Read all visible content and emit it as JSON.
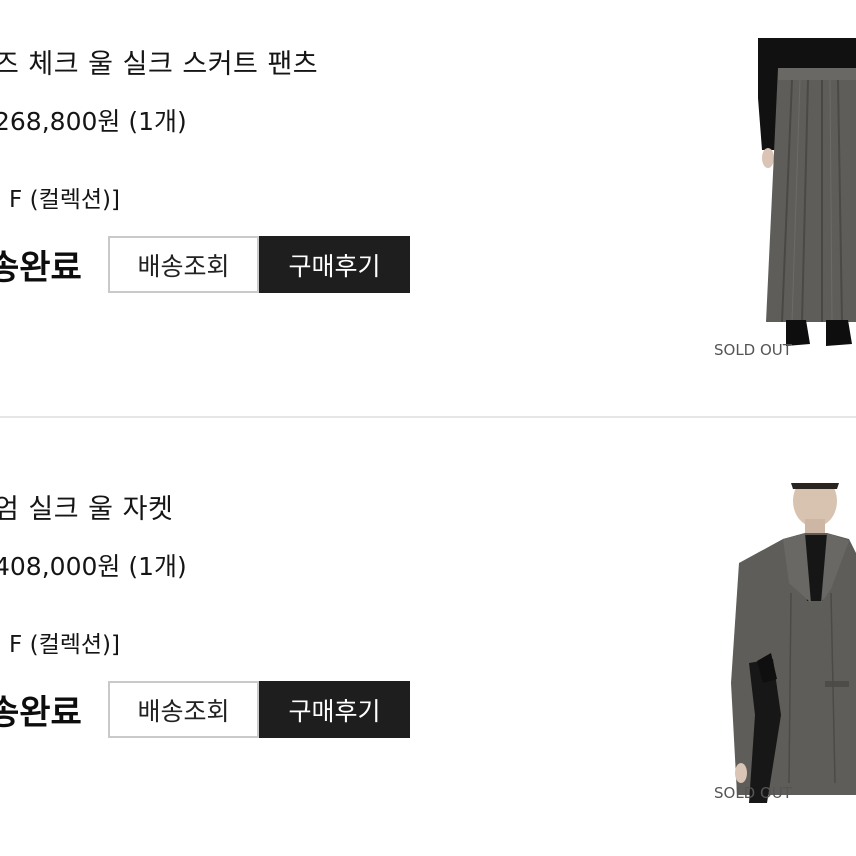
{
  "orders": [
    {
      "name": "즈 체크 울 실크 스커트 팬츠",
      "price": "268,800원 (1개)",
      "option": ": F (컬렉션)]",
      "status": "송완료",
      "track_label": "배송조회",
      "review_label": "구매후기",
      "image_label": "SOLD OUT"
    },
    {
      "name": "엄 실크 울 자켓",
      "price": "408,000원 (1개)",
      "option": ": F (컬렉션)]",
      "status": "송완료",
      "track_label": "배송조회",
      "review_label": "구매후기",
      "image_label": "SOLD OUT"
    }
  ],
  "colors": {
    "review_button_bg": "#1e1e1e",
    "track_button_border": "#c9c9c9",
    "garment_gray": "#5f5d59",
    "divider": "#e6e6e6"
  }
}
